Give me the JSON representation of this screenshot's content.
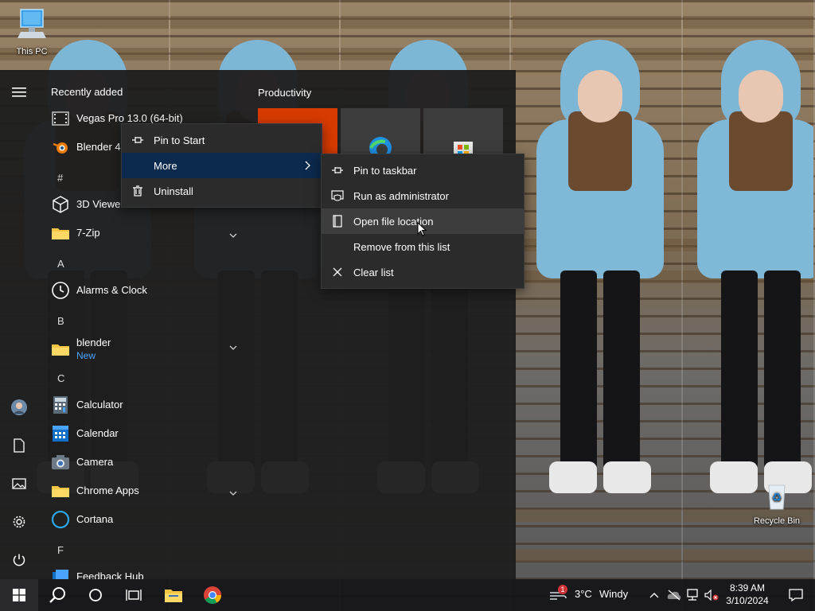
{
  "desktop": {
    "icons": [
      {
        "label": "This PC",
        "icon": "computer-icon"
      },
      {
        "label": "Recycle Bin",
        "icon": "recycle-bin-icon"
      }
    ]
  },
  "start_menu": {
    "rail": [
      "hamburger-menu-icon",
      "user-avatar-icon",
      "documents-icon",
      "pictures-icon",
      "settings-gear-icon",
      "power-icon"
    ],
    "recently_added_title": "Recently added",
    "apps": [
      {
        "label": "Vegas Pro 13.0 (64-bit)",
        "icon": "vegas-film-icon"
      },
      {
        "label": "Blender 4.0",
        "icon": "blender-icon"
      },
      {
        "label": "#",
        "letter": true
      },
      {
        "label": "3D Viewer",
        "icon": "cube-icon"
      },
      {
        "label": "7-Zip",
        "icon": "folder-icon",
        "expand": true
      },
      {
        "label": "A",
        "letter": true
      },
      {
        "label": "Alarms & Clock",
        "icon": "clock-icon"
      },
      {
        "label": "B",
        "letter": true
      },
      {
        "label": "blender",
        "sub": "New",
        "icon": "folder-icon",
        "expand": true
      },
      {
        "label": "C",
        "letter": true
      },
      {
        "label": "Calculator",
        "icon": "calculator-icon"
      },
      {
        "label": "Calendar",
        "icon": "calendar-icon"
      },
      {
        "label": "Camera",
        "icon": "camera-icon"
      },
      {
        "label": "Chrome Apps",
        "icon": "folder-icon",
        "expand": true
      },
      {
        "label": "Cortana",
        "icon": "cortana-icon"
      },
      {
        "label": "F",
        "letter": true
      },
      {
        "label": "Feedback Hub",
        "icon": "feedback-icon"
      }
    ],
    "tiles_group_title": "Productivity"
  },
  "context_menu": {
    "items": [
      {
        "label": "Pin to Start",
        "icon": "pin-icon"
      },
      {
        "label": "More",
        "icon": "",
        "submenu": true
      },
      {
        "label": "Uninstall",
        "icon": "trash-icon"
      }
    ]
  },
  "submenu": {
    "items": [
      {
        "label": "Pin to taskbar",
        "icon": "pin-icon"
      },
      {
        "label": "Run as administrator",
        "icon": "shield-window-icon"
      },
      {
        "label": "Open file location",
        "icon": "document-icon"
      },
      {
        "label": "Remove from this list",
        "icon": ""
      },
      {
        "label": "Clear list",
        "icon": "close-icon"
      }
    ]
  },
  "taskbar": {
    "buttons": [
      "windows-start-icon",
      "search-icon",
      "cortana-circle-icon",
      "task-view-icon",
      "file-explorer-icon",
      "chrome-icon"
    ],
    "weather_temp": "3°C",
    "weather_desc": "Windy",
    "notification_badge": "1",
    "time": "8:39 AM",
    "date": "3/10/2024"
  },
  "colors": {
    "accent_blue": "#0078d7",
    "link_blue": "#4aa3ff",
    "office_tile": "#d83b01"
  }
}
